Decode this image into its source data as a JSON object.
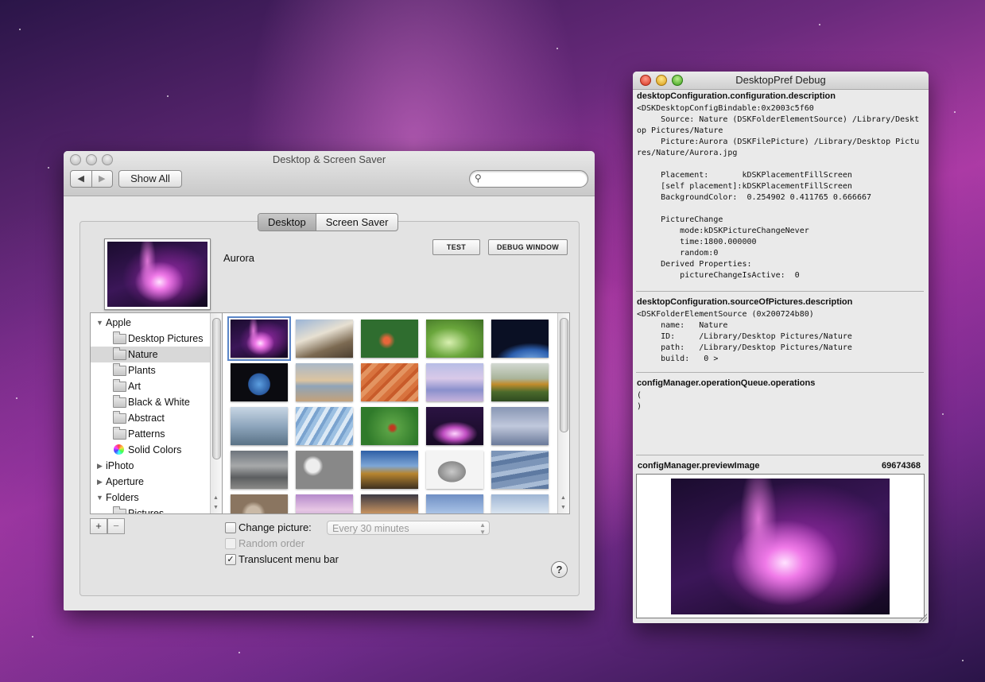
{
  "prefs_window": {
    "title": "Desktop & Screen Saver",
    "back_glyph": "◀",
    "forward_glyph": "▶",
    "show_all_label": "Show All",
    "search_placeholder": "",
    "tabs": [
      {
        "label": "Desktop",
        "active": true
      },
      {
        "label": "Screen Saver",
        "active": false
      }
    ],
    "selected_picture_name": "Aurora",
    "test_button": "TEST",
    "debug_window_button": "DEBUG WINDOW",
    "source_list": [
      {
        "label": "Apple",
        "level": 0,
        "expanded": true,
        "icon": "disclosure-triangle"
      },
      {
        "label": "Desktop Pictures",
        "level": 1,
        "icon": "folder-icon"
      },
      {
        "label": "Nature",
        "level": 1,
        "icon": "folder-icon",
        "selected": true
      },
      {
        "label": "Plants",
        "level": 1,
        "icon": "folder-icon"
      },
      {
        "label": "Art",
        "level": 1,
        "icon": "folder-icon"
      },
      {
        "label": "Black & White",
        "level": 1,
        "icon": "folder-icon"
      },
      {
        "label": "Abstract",
        "level": 1,
        "icon": "folder-icon"
      },
      {
        "label": "Patterns",
        "level": 1,
        "icon": "folder-icon"
      },
      {
        "label": "Solid Colors",
        "level": 1,
        "icon": "color-wheel-icon"
      },
      {
        "label": "iPhoto",
        "level": 0,
        "expanded": false,
        "icon": "disclosure-triangle"
      },
      {
        "label": "Aperture",
        "level": 0,
        "expanded": false,
        "icon": "disclosure-triangle"
      },
      {
        "label": "Folders",
        "level": 0,
        "expanded": true,
        "icon": "disclosure-triangle"
      },
      {
        "label": "Pictures",
        "level": 1,
        "icon": "folder-icon"
      }
    ],
    "add_label": "+",
    "remove_label": "−",
    "change_picture_label": "Change picture:",
    "change_picture_checked": false,
    "interval_value": "Every 30 minutes",
    "random_order_label": "Random order",
    "random_order_checked": false,
    "translucent_menu_bar_label": "Translucent menu bar",
    "translucent_menu_bar_checked": true,
    "check_glyph": "✓",
    "help_label": "?"
  },
  "debug_window": {
    "title": "DesktopPref Debug",
    "sections": [
      {
        "heading": "desktopConfiguration.configuration.description",
        "body": "<DSKDesktopConfigBindable:0x2003c5f60\n     Source: Nature (DSKFolderElementSource) /Library/Deskt\nop Pictures/Nature\n     Picture:Aurora (DSKFilePicture) /Library/Desktop Pictu\nres/Nature/Aurora.jpg\n\n     Placement:       kDSKPlacementFillScreen\n     [self placement]:kDSKPlacementFillScreen\n     BackgroundColor:  0.254902 0.411765 0.666667\n\n     PictureChange\n         mode:kDSKPictureChangeNever\n         time:1800.000000\n         random:0\n     Derived Properties:\n         pictureChangeIsActive:  0"
      },
      {
        "heading": "desktopConfiguration.sourceOfPictures.description",
        "body": "<DSKFolderElementSource (0x200724b80)\n     name:   Nature\n     ID:     /Library/Desktop Pictures/Nature\n     path:   /Library/Desktop Pictures/Nature\n     build:   0 >"
      },
      {
        "heading": "configManager.operationQueue.operations",
        "body": "(\n)"
      }
    ],
    "preview_heading": "configManager.previewImage",
    "preview_value": "69674368"
  }
}
